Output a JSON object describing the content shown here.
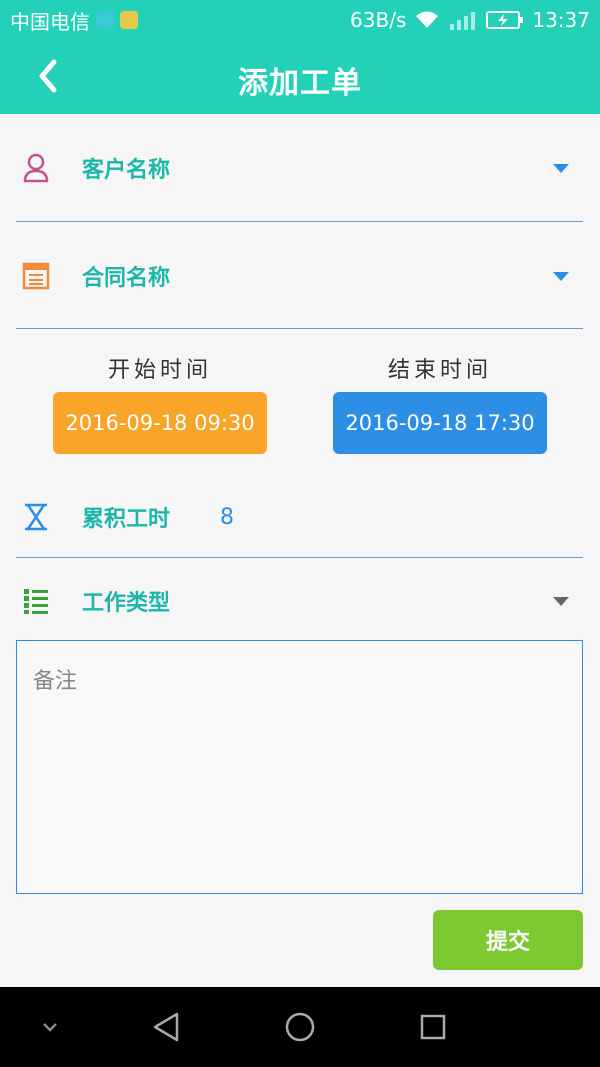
{
  "status_bar": {
    "carrier": "中国电信",
    "speed": "63B/s",
    "time": "13:37"
  },
  "app_bar": {
    "title": "添加工单",
    "back_icon": "chevron-left-icon"
  },
  "form": {
    "customer": {
      "label": "客户名称",
      "icon": "person-icon"
    },
    "contract": {
      "label": "合同名称",
      "icon": "document-icon"
    },
    "start": {
      "label": "开始时间",
      "value": "2016-09-18 09:30"
    },
    "end": {
      "label": "结束时间",
      "value": "2016-09-18 17:30"
    },
    "hours": {
      "label": "累积工时",
      "value": "8",
      "icon": "hourglass-icon"
    },
    "work_type": {
      "label": "工作类型",
      "icon": "list-icon"
    },
    "notes": {
      "placeholder": "备注"
    },
    "submit_label": "提交"
  },
  "colors": {
    "accent": "#23d1b8",
    "blue": "#2d8ee6",
    "orange": "#f8a428",
    "green": "#7cc932"
  },
  "nav_bar": {
    "items": [
      "chevron-down-icon",
      "back-triangle-icon",
      "home-circle-icon",
      "recents-square-icon"
    ]
  }
}
